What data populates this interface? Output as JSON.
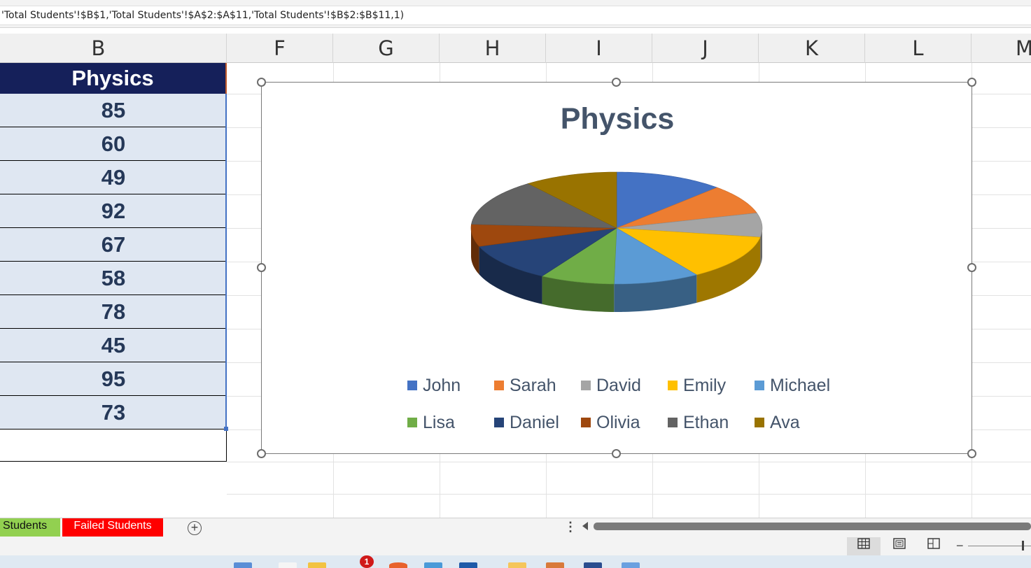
{
  "formula_bar": {
    "formula": "'Total Students'!$B$1,'Total Students'!$A$2:$A$11,'Total Students'!$B$2:$B$11,1)"
  },
  "columns": [
    "B",
    "F",
    "G",
    "H",
    "I",
    "J",
    "K",
    "L",
    "M"
  ],
  "column_b": {
    "header": "Physics",
    "values": [
      "85",
      "60",
      "49",
      "92",
      "67",
      "58",
      "78",
      "45",
      "95",
      "73"
    ]
  },
  "chart_data": {
    "type": "pie",
    "style": "3d",
    "title": "Physics",
    "categories": [
      "John",
      "Sarah",
      "David",
      "Emily",
      "Michael",
      "Lisa",
      "Daniel",
      "Olivia",
      "Ethan",
      "Ava"
    ],
    "values": [
      85,
      60,
      49,
      92,
      67,
      58,
      78,
      45,
      95,
      73
    ],
    "colors": [
      "#4472c4",
      "#ed7d31",
      "#a5a5a5",
      "#ffc000",
      "#5b9bd5",
      "#70ad47",
      "#264478",
      "#9e480e",
      "#636363",
      "#997300"
    ],
    "legend": "bottom"
  },
  "sheet_tabs": [
    {
      "label": "Students",
      "color": "#92d050"
    },
    {
      "label": "Failed Students",
      "color": "#ff0000"
    }
  ],
  "icons": {
    "add_sheet": "plus-circle-icon",
    "more": "vertical-dots-icon",
    "scroll_left": "triangle-left-icon",
    "view_normal": "grid-view-icon",
    "view_layout": "page-layout-icon",
    "view_break": "page-break-icon",
    "zoom_out": "minus-icon"
  },
  "status": {
    "zoom_minus": "−",
    "taskbar_badge": "1"
  }
}
